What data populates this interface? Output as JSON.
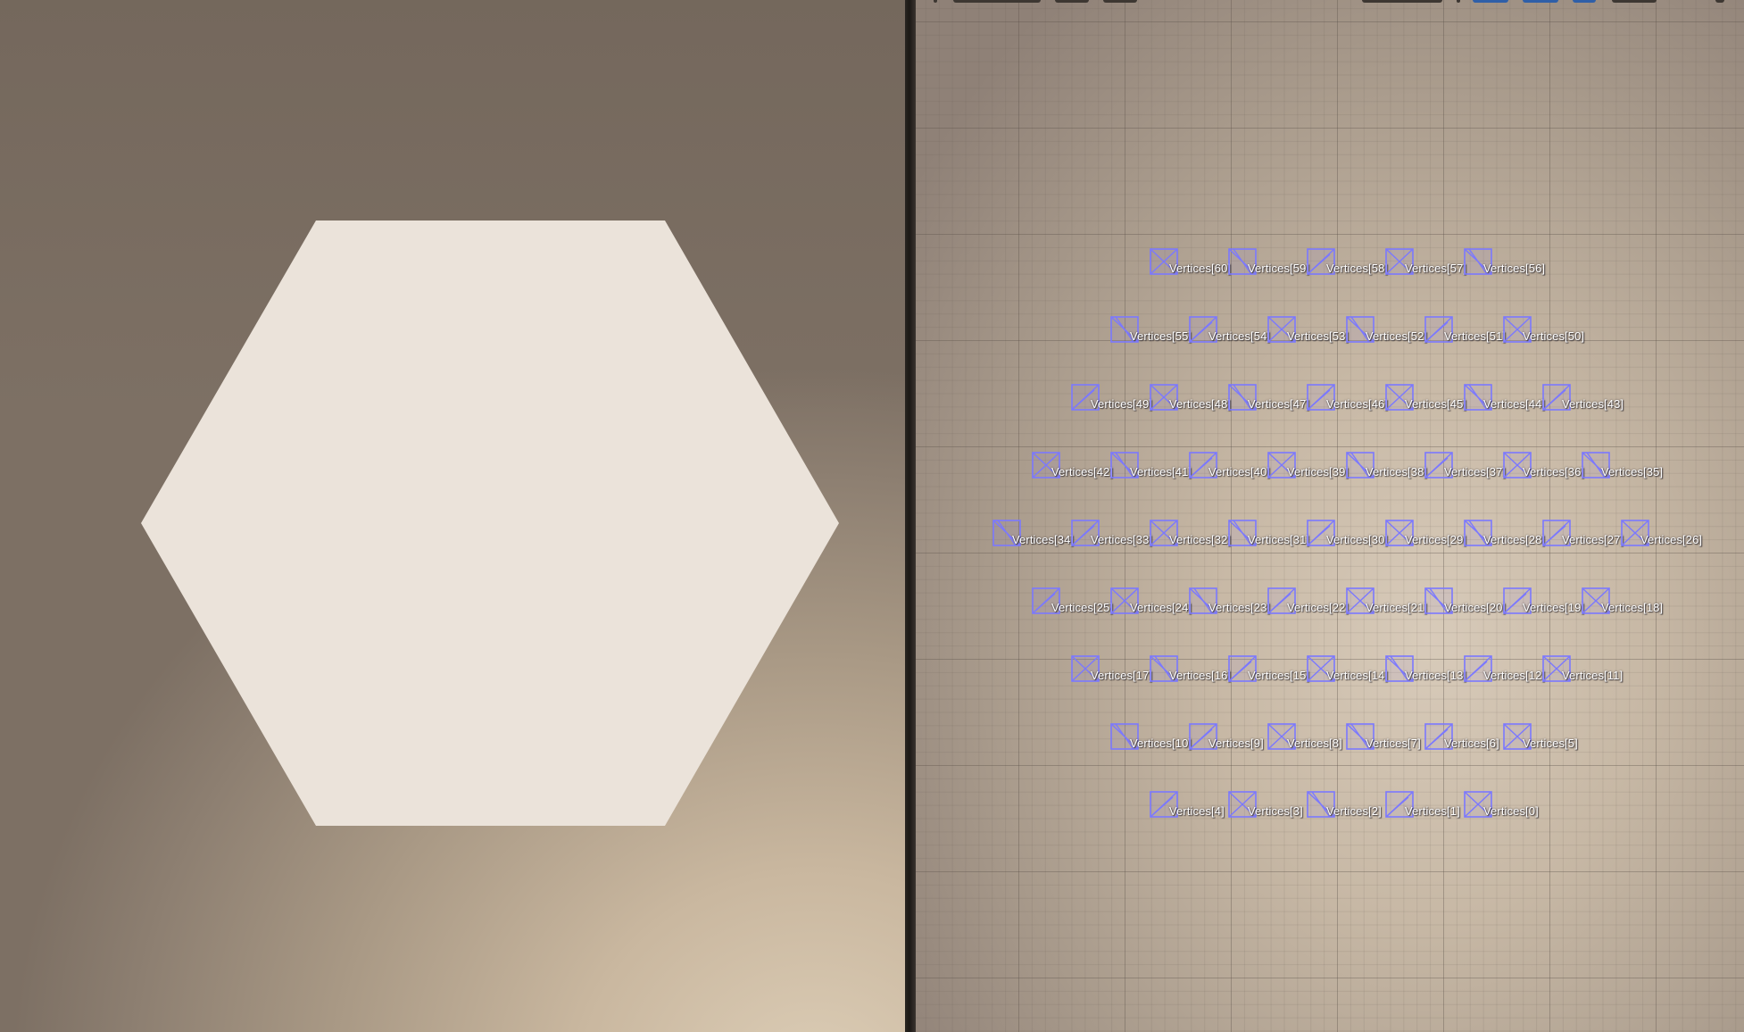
{
  "colors": {
    "hexagon_fill": "#ebe3da",
    "vertex_gizmo": "#7b78ff"
  },
  "left_viewport": {
    "shape": "hexagon"
  },
  "right_viewport": {
    "vertex_rows": [
      [
        "Vertices[60]",
        "Vertices[59]",
        "Vertices[58]",
        "Vertices[57]",
        "Vertices[56]"
      ],
      [
        "Vertices[55]",
        "Vertices[54]",
        "Vertices[53]",
        "Vertices[52]",
        "Vertices[51]",
        "Vertices[50]"
      ],
      [
        "Vertices[49]",
        "Vertices[48]",
        "Vertices[47]",
        "Vertices[46]",
        "Vertices[45]",
        "Vertices[44]",
        "Vertices[43]"
      ],
      [
        "Vertices[42]",
        "Vertices[41]",
        "Vertices[40]",
        "Vertices[39]",
        "Vertices[38]",
        "Vertices[37]",
        "Vertices[36]",
        "Vertices[35]"
      ],
      [
        "Vertices[34]",
        "Vertices[33]",
        "Vertices[32]",
        "Vertices[31]",
        "Vertices[30]",
        "Vertices[29]",
        "Vertices[28]",
        "Vertices[27]",
        "Vertices[26]"
      ],
      [
        "Vertices[25]",
        "Vertices[24]",
        "Vertices[23]",
        "Vertices[22]",
        "Vertices[21]",
        "Vertices[20]",
        "Vertices[19]",
        "Vertices[18]"
      ],
      [
        "Vertices[17]",
        "Vertices[16]",
        "Vertices[15]",
        "Vertices[14]",
        "Vertices[13]",
        "Vertices[12]",
        "Vertices[11]"
      ],
      [
        "Vertices[10]",
        "Vertices[9]",
        "Vertices[8]",
        "Vertices[7]",
        "Vertices[6]",
        "Vertices[5]"
      ],
      [
        "Vertices[4]",
        "Vertices[3]",
        "Vertices[2]",
        "Vertices[1]",
        "Vertices[0]"
      ]
    ]
  }
}
